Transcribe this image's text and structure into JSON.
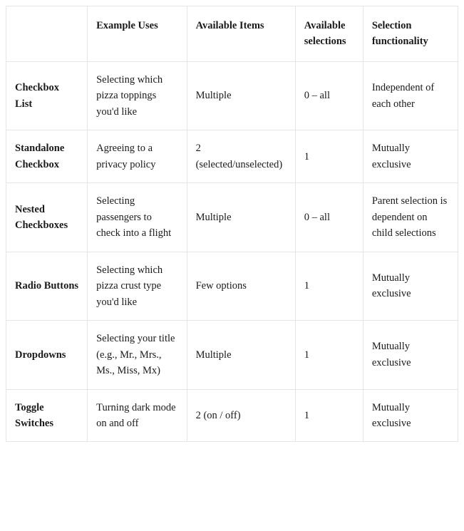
{
  "table": {
    "headers": {
      "blank": "",
      "example_uses": "Example Uses",
      "available_items": "Available Items",
      "available_selections": "Available selections",
      "selection_functionality": "Selection functionality"
    },
    "rows": [
      {
        "name": "Checkbox List",
        "example_uses": "Selecting which pizza toppings you'd like",
        "available_items": "Multiple",
        "available_selections": "0 – all",
        "selection_functionality": "Independent of each other"
      },
      {
        "name": "Standalone Checkbox",
        "example_uses": "Agreeing to a privacy policy",
        "available_items": "2 (selected/unselected)",
        "available_selections": "1",
        "selection_functionality": "Mutually exclusive"
      },
      {
        "name": "Nested Checkboxes",
        "example_uses": "Selecting passengers to check into a flight",
        "available_items": "Multiple",
        "available_selections": "0 – all",
        "selection_functionality": "Parent selection is dependent on child selections"
      },
      {
        "name": "Radio Buttons",
        "example_uses": "Selecting which pizza crust type you'd like",
        "available_items": "Few options",
        "available_selections": "1",
        "selection_functionality": "Mutually exclusive"
      },
      {
        "name": "Dropdowns",
        "example_uses": "Selecting your title (e.g., Mr., Mrs., Ms., Miss, Mx)",
        "available_items": "Multiple",
        "available_selections": "1",
        "selection_functionality": "Mutually exclusive"
      },
      {
        "name": "Toggle Switches",
        "example_uses": "Turning dark mode on and off",
        "available_items": "2 (on / off)",
        "available_selections": "1",
        "selection_functionality": "Mutually exclusive"
      }
    ]
  }
}
